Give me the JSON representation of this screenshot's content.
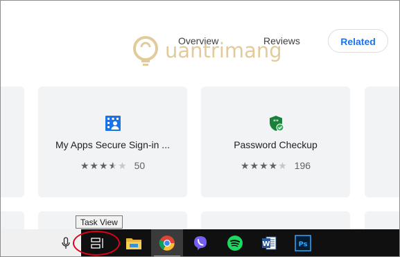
{
  "tabs": [
    {
      "label": "Overview"
    },
    {
      "label": "Reviews"
    },
    {
      "label": "Related",
      "active": true
    }
  ],
  "watermark": {
    "text": "uantrimang"
  },
  "cards": [
    {
      "title": "My Apps Secure Sign-in ...",
      "icon": "my-apps-building-icon",
      "rating": 3.5,
      "rating_count": "50"
    },
    {
      "title": "Password Checkup",
      "icon": "password-shield-check-icon",
      "rating": 4.0,
      "rating_count": "196"
    }
  ],
  "taskbar": {
    "tooltip": "Task View",
    "items": [
      "microphone-icon",
      "task-view-icon",
      "file-explorer-icon",
      "chrome-icon",
      "viber-icon",
      "spotify-icon",
      "word-icon",
      "photoshop-icon"
    ]
  },
  "colors": {
    "accent": "#1a73e8",
    "card_bg": "#f1f3f4",
    "taskbar_bg": "#101010",
    "highlight": "#e0001b"
  }
}
